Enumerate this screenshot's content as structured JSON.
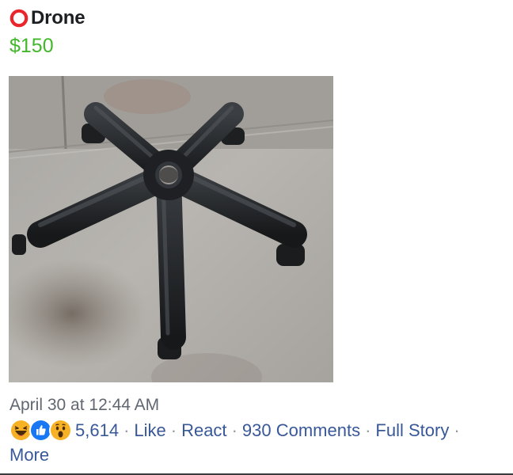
{
  "post": {
    "title": "Drone",
    "price": "$150",
    "timestamp": "April 30 at 12:44 AM",
    "reactions": [
      "haha",
      "like",
      "wow"
    ],
    "reaction_count": "5,614",
    "actions": {
      "like": "Like",
      "react": "React",
      "comments": "930 Comments",
      "full_story": "Full Story",
      "more": "More"
    },
    "separator": "·"
  },
  "colors": {
    "price": "#42b72a",
    "link": "#385898",
    "marker": "#e8262b",
    "timestamp": "#616770"
  },
  "icons": {
    "title_marker": "red-ring-icon",
    "haha": "haha-reaction-icon",
    "like": "like-reaction-icon",
    "wow": "wow-reaction-icon"
  }
}
